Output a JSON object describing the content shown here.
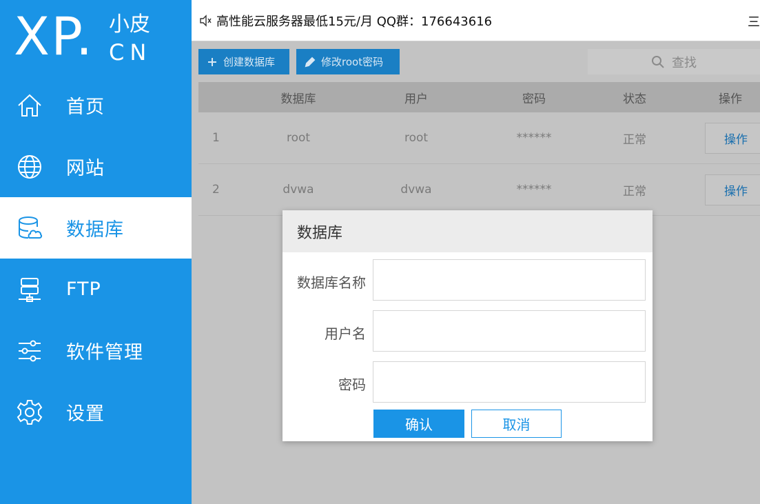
{
  "logo": {
    "main": "XP.",
    "cn_top": "小皮",
    "cn_bottom": "CN"
  },
  "sidebar": {
    "items": [
      {
        "label": "首页",
        "icon": "home-icon",
        "active": false
      },
      {
        "label": "网站",
        "icon": "globe-icon",
        "active": false
      },
      {
        "label": "数据库",
        "icon": "database-icon",
        "active": true
      },
      {
        "label": "FTP",
        "icon": "server-icon",
        "active": false
      },
      {
        "label": "软件管理",
        "icon": "sliders-icon",
        "active": false
      },
      {
        "label": "设置",
        "icon": "gear-icon",
        "active": false
      }
    ]
  },
  "topbar": {
    "notice": "高性能云服务器最低15元/月  QQ群：176643616",
    "edge_char": "三"
  },
  "toolbar": {
    "create_label": "创建数据库",
    "modify_root_label": "修改root密码",
    "search_label": "查找"
  },
  "table": {
    "headers": [
      "",
      "数据库",
      "用户",
      "密码",
      "状态",
      "操作"
    ],
    "rows": [
      {
        "index": "1",
        "database": "root",
        "user": "root",
        "password": "******",
        "status": "正常",
        "action": "操作"
      },
      {
        "index": "2",
        "database": "dvwa",
        "user": "dvwa",
        "password": "******",
        "status": "正常",
        "action": "操作"
      }
    ]
  },
  "modal": {
    "title": "数据库",
    "fields": [
      {
        "label": "数据库名称",
        "value": ""
      },
      {
        "label": "用户名",
        "value": ""
      },
      {
        "label": "密码",
        "value": ""
      }
    ],
    "confirm_label": "确认",
    "cancel_label": "取消"
  },
  "colors": {
    "brand": "#1a94e6",
    "toolbar_button": "#1a7fc4",
    "overlay": "#c3c3c3"
  }
}
